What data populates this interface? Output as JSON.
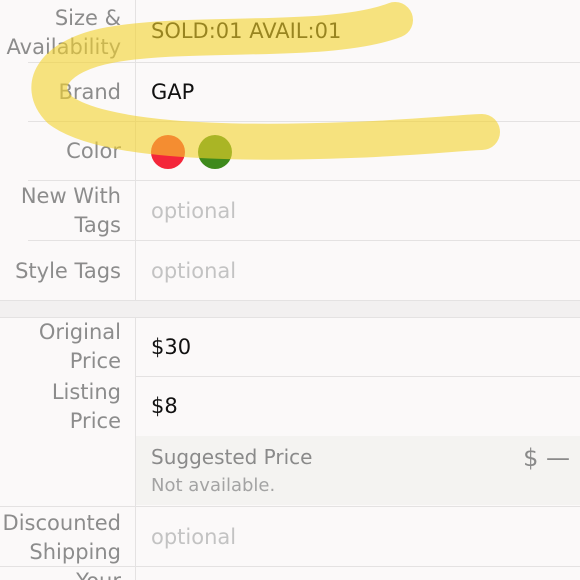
{
  "size": {
    "label_line1": "Size &",
    "label_line2": "Availability",
    "value": "SOLD:01  AVAIL:01"
  },
  "brand": {
    "label": "Brand",
    "value": "GAP"
  },
  "color": {
    "label": "Color",
    "swatches": [
      "#f4263a",
      "#3e8a1c"
    ]
  },
  "new_with_tags": {
    "label_line1": "New With",
    "label_line2": "Tags",
    "placeholder": "optional"
  },
  "style_tags": {
    "label": "Style Tags",
    "placeholder": "optional"
  },
  "original_price": {
    "label_line1": "Original",
    "label_line2": "Price",
    "value": "$30"
  },
  "listing_price": {
    "label_line1": "Listing",
    "label_line2": "Price",
    "value": "$8"
  },
  "suggested_price": {
    "title": "Suggested Price",
    "status": "Not available.",
    "amount": "$ —"
  },
  "discounted_shipping": {
    "label_line1": "Discounted",
    "label_line2": "Shipping",
    "placeholder": "optional"
  },
  "next_row": {
    "label_partial": "Your"
  },
  "annotation": {
    "color": "#f3d22b"
  }
}
